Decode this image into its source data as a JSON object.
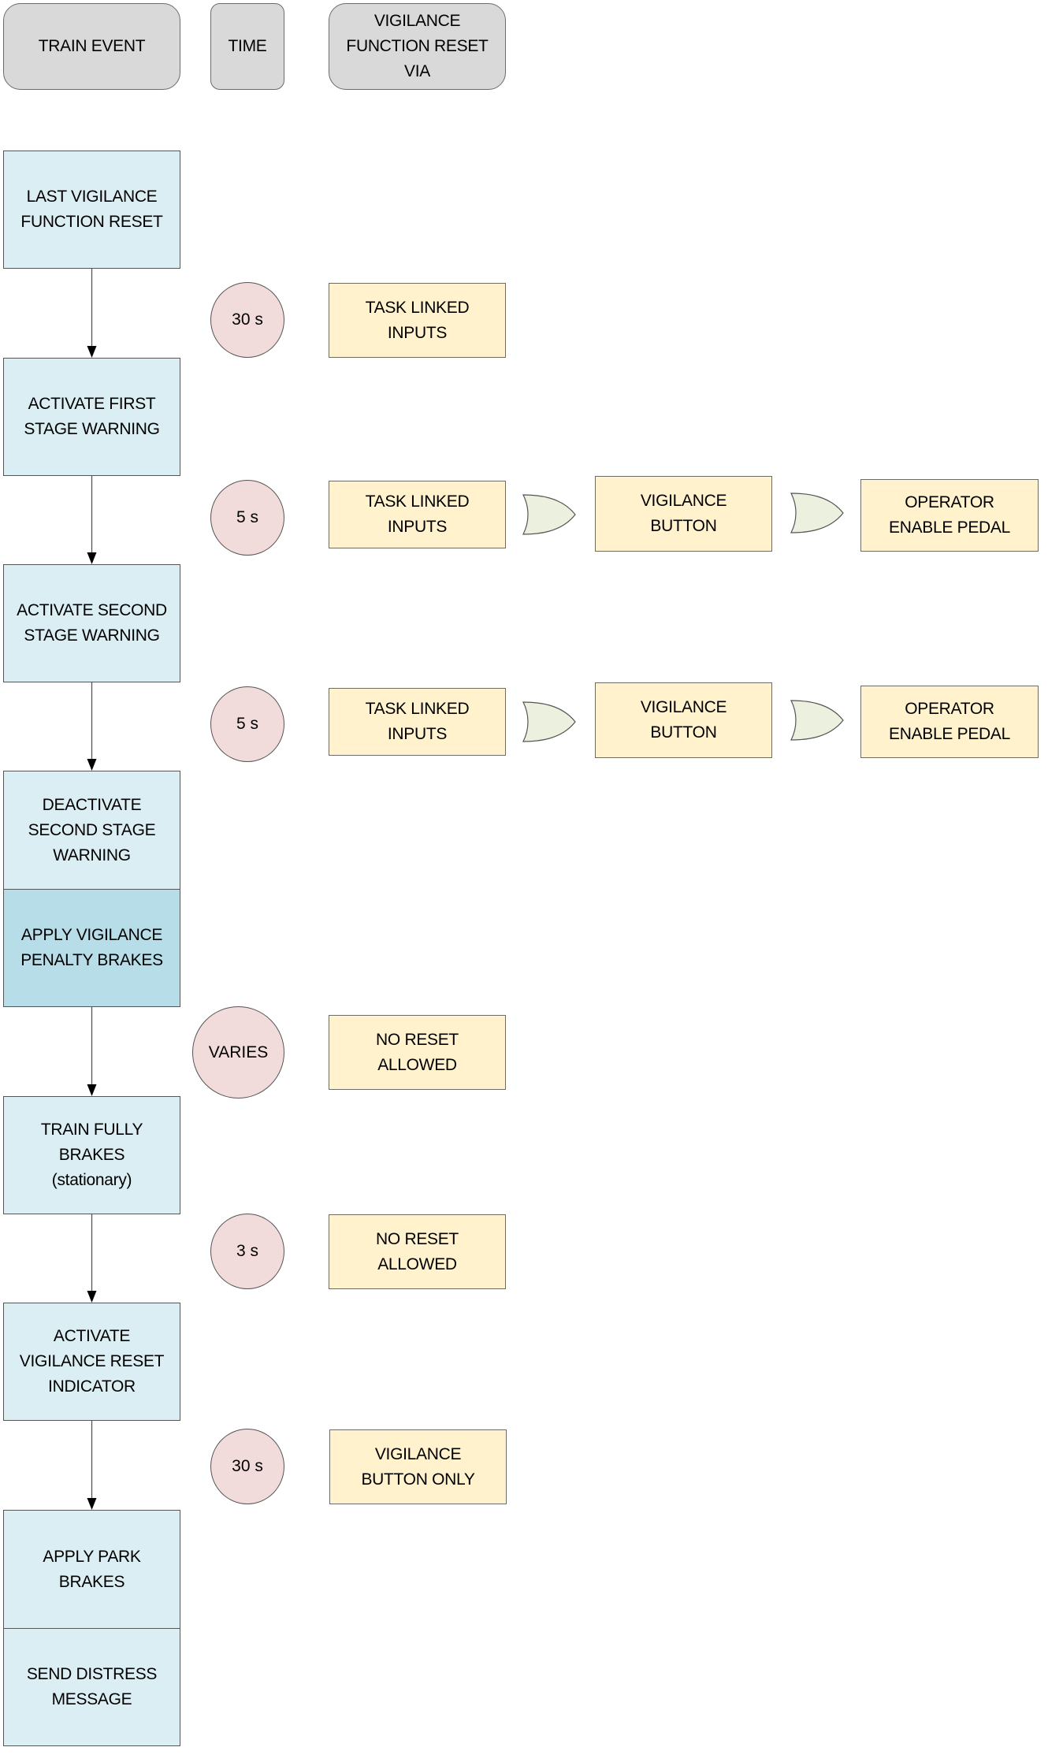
{
  "headers": {
    "event": "TRAIN EVENT",
    "time": "TIME",
    "reset": "VIGILANCE\nFUNCTION RESET\nVIA"
  },
  "events": [
    "LAST VIGILANCE\nFUNCTION RESET",
    "ACTIVATE FIRST\nSTAGE WARNING",
    "ACTIVATE SECOND\nSTAGE WARNING",
    "DEACTIVATE\nSECOND STAGE\nWARNING",
    "APPLY VIGILANCE\nPENALTY BRAKES",
    "TRAIN FULLY\nBRAKES\n(stationary)",
    "ACTIVATE\nVIGILANCE RESET\nINDICATOR",
    "APPLY PARK\nBRAKES",
    "SEND DISTRESS\nMESSAGE"
  ],
  "steps": [
    {
      "time": "30 s",
      "resets": [
        "TASK LINKED\nINPUTS"
      ]
    },
    {
      "time": "5 s",
      "resets": [
        "TASK LINKED\nINPUTS",
        "VIGILANCE\nBUTTON",
        "OPERATOR\nENABLE PEDAL"
      ]
    },
    {
      "time": "5 s",
      "resets": [
        "TASK LINKED\nINPUTS",
        "VIGILANCE\nBUTTON",
        "OPERATOR\nENABLE PEDAL"
      ]
    },
    {
      "time": "VARIES",
      "resets": [
        "NO RESET\nALLOWED"
      ]
    },
    {
      "time": "3 s",
      "resets": [
        "NO RESET\nALLOWED"
      ]
    },
    {
      "time": "30 s",
      "resets": [
        "VIGILANCE\nBUTTON ONLY"
      ]
    }
  ],
  "gate_label": "OR",
  "colors": {
    "header": "#d9d9d9",
    "event": "#dbeef4",
    "penalty_event": "#b7dde8",
    "time": "#f2dcdb",
    "reset": "#fff2cc",
    "gate": "#ebf1de"
  }
}
